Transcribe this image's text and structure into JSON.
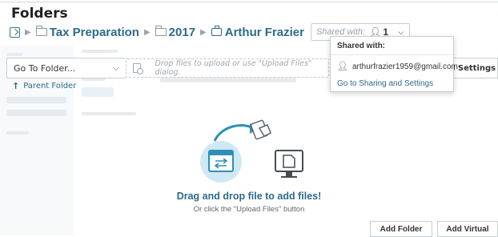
{
  "page": {
    "title": "Folders"
  },
  "breadcrumb": {
    "items": [
      "Tax Preparation",
      "2017",
      "Arthur Frazier"
    ],
    "shared_with_label": "Shared with:",
    "shared_count": "1"
  },
  "sidebar": {
    "go_to_folder": "Go To Folder...",
    "parent_folder": "Parent Folder"
  },
  "upload": {
    "drop_hint": "Drop files to upload or use \"Upload Files\" dialog."
  },
  "popup": {
    "title": "Shared with:",
    "email": "arthurfrazier1959@gmail.com",
    "link": "Go to Sharing and Settings"
  },
  "settings_button": "l Settings",
  "dropzone": {
    "title": "Drag and drop file to add files!",
    "subtitle": "Or click the \"Upload Files\" button"
  },
  "buttons": {
    "add_folder": "Add Folder",
    "add_virtual": "Add Virtual"
  },
  "colors": {
    "accent": "#2e6a89",
    "illustration": "#5bb3d6"
  },
  "icons": [
    "root-folder-icon",
    "folder-icon",
    "client-icon",
    "person-icon",
    "chevron-down-icon",
    "up-arrow-icon",
    "upload-file-icon"
  ]
}
